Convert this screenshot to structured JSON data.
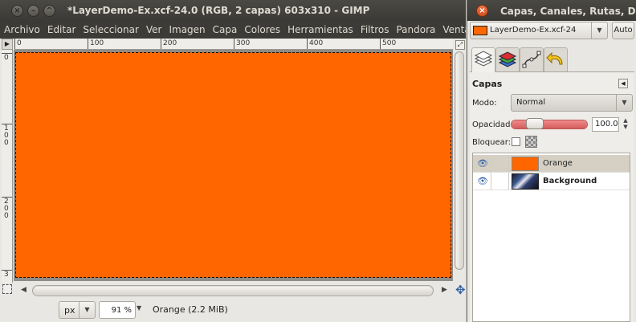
{
  "image_window": {
    "title": "*LayerDemo-Ex.xcf-24.0 (RGB, 2 capas) 603x310 - GIMP",
    "menu": [
      "Archivo",
      "Editar",
      "Seleccionar",
      "Ver",
      "Imagen",
      "Capa",
      "Colores",
      "Herramientas",
      "Filtros",
      "Pandora",
      "Ventanas"
    ],
    "ruler_top_labels": [
      "0",
      "100",
      "200",
      "300",
      "400",
      "500"
    ],
    "ruler_left_labels": [
      "0",
      "100",
      "200",
      "3"
    ],
    "canvas_color": "#ff6600",
    "statusbar": {
      "unit": "px",
      "zoom": "91 %",
      "status": "Orange (2.2 MiB)"
    }
  },
  "dock": {
    "title": "Capas, Canales, Rutas, De",
    "image_selector": "LayerDemo-Ex.xcf-24",
    "auto_button": "Auto",
    "tabs": [
      "layers-tab",
      "channels-tab",
      "paths-tab",
      "undo-tab"
    ],
    "panel": {
      "title": "Capas",
      "mode_label": "Modo:",
      "mode_value": "Normal",
      "opacity_label": "Opacidad:",
      "opacity_value": "100.0",
      "opacity_fraction": 1.0,
      "lock_label": "Bloquear:"
    },
    "layers": [
      {
        "name": "Orange",
        "visible": true,
        "selected": true
      },
      {
        "name": "Background",
        "visible": true,
        "selected": false
      }
    ]
  }
}
